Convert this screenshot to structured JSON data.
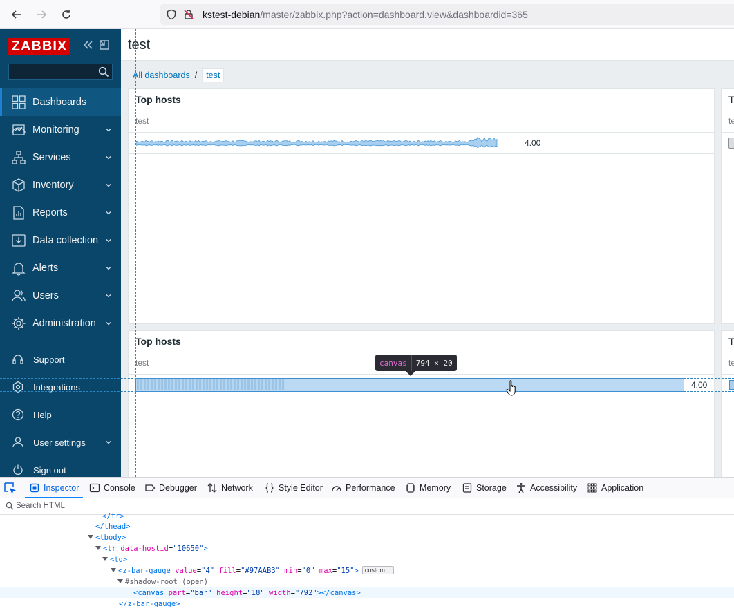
{
  "browser": {
    "url_host": "kstest-debian",
    "url_path": "/master/zabbix.php?action=dashboard.view&dashboardid=365"
  },
  "sidebar": {
    "logo": "ZABBIX",
    "search_value": "",
    "items": [
      {
        "label": "Dashboards",
        "icon": "dashboards-icon",
        "active": true
      },
      {
        "label": "Monitoring",
        "icon": "monitoring-icon"
      },
      {
        "label": "Services",
        "icon": "services-icon"
      },
      {
        "label": "Inventory",
        "icon": "inventory-icon"
      },
      {
        "label": "Reports",
        "icon": "reports-icon"
      },
      {
        "label": "Data collection",
        "icon": "data-collection-icon"
      },
      {
        "label": "Alerts",
        "icon": "alerts-icon"
      },
      {
        "label": "Users",
        "icon": "users-icon"
      },
      {
        "label": "Administration",
        "icon": "administration-icon"
      }
    ],
    "bottom_items": [
      {
        "label": "Support",
        "icon": "support-icon"
      },
      {
        "label": "Integrations",
        "icon": "integrations-icon"
      },
      {
        "label": "Help",
        "icon": "help-icon"
      },
      {
        "label": "User settings",
        "icon": "user-settings-icon"
      },
      {
        "label": "Sign out",
        "icon": "sign-out-icon"
      }
    ]
  },
  "page": {
    "title": "test",
    "breadcrumb": {
      "root": "All dashboards",
      "separator": "/",
      "current": "test"
    }
  },
  "widgets": [
    {
      "title": "Top hosts",
      "subtitle": "test",
      "value": "4.00"
    },
    {
      "title": "Top hosts",
      "subtitle": "test",
      "value": "4.00"
    },
    {
      "title": "T",
      "subtitle": "te"
    },
    {
      "title": "T",
      "subtitle": "te"
    }
  ],
  "inspector_tooltip": {
    "tag": "canvas",
    "size": "794 × 20"
  },
  "devtools": {
    "tabs": [
      "Inspector",
      "Console",
      "Debugger",
      "Network",
      "Style Editor",
      "Performance",
      "Memory",
      "Storage",
      "Accessibility",
      "Application"
    ],
    "search_placeholder": "Search HTML",
    "code": {
      "tr_close": "</tr>",
      "thead_close": "</thead>",
      "tbody_open": "<tbody>",
      "tr_tag": "tr",
      "tr_attr": "data-hostid",
      "tr_val": "\"10650\"",
      "td_open": "<td>",
      "gauge_tag": "z-bar-gauge",
      "gauge_attrs": [
        {
          "name": "value",
          "val": "\"4\""
        },
        {
          "name": "fill",
          "val": "\"#97AAB3\""
        },
        {
          "name": "min",
          "val": "\"0\""
        },
        {
          "name": "max",
          "val": "\"15\""
        }
      ],
      "badge": "custom…",
      "shadow_root": "#shadow-root (open)",
      "canvas_tag": "canvas",
      "canvas_attrs": [
        {
          "name": "part",
          "val": "\"bar\""
        },
        {
          "name": "height",
          "val": "\"18\""
        },
        {
          "name": "width",
          "val": "\"792\""
        }
      ],
      "canvas_close": "</canvas>",
      "gauge_close": "</z-bar-gauge>"
    }
  },
  "colors": {
    "sidebar": "#0a466a",
    "logo": "#d40000",
    "bar": "#3d8fd1",
    "bar_fill": "#a8cff0"
  }
}
